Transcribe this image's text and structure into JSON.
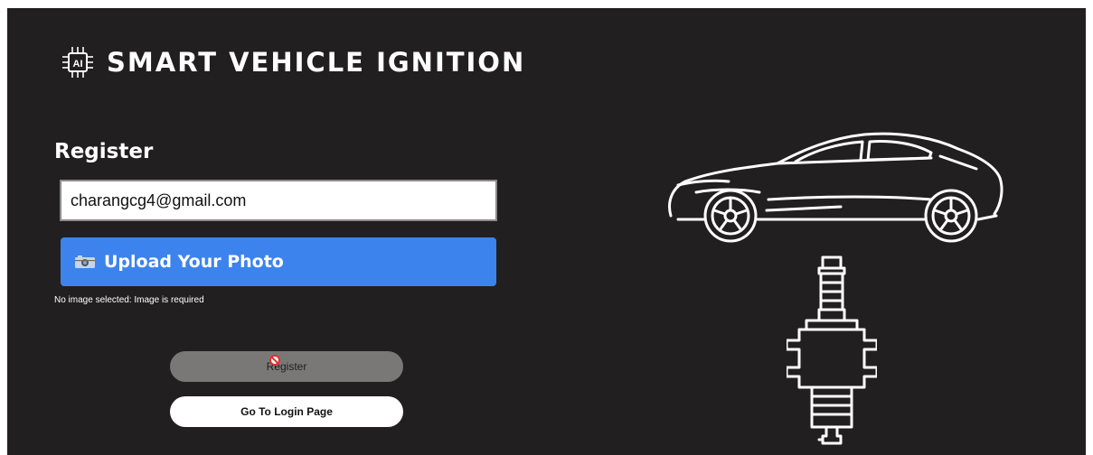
{
  "brand": {
    "icon": "ai-chip-icon",
    "title": "SMART VEHICLE IGNITION"
  },
  "form": {
    "heading": "Register",
    "email_value": "charangcg4@gmail.com",
    "upload_label": "Upload Your Photo",
    "upload_icon": "camera-icon",
    "hint": "No image selected: Image is required",
    "register_label": "Register",
    "register_disabled_icon": "not-allowed-icon",
    "login_label": "Go To Login Page"
  },
  "illustrations": {
    "car": "car-illustration",
    "spark_plug": "spark-plug-illustration"
  },
  "colors": {
    "background": "#221f20",
    "upload_button": "#3d83ee",
    "register_button_disabled": "#7a7877",
    "login_button": "#ffffff"
  }
}
